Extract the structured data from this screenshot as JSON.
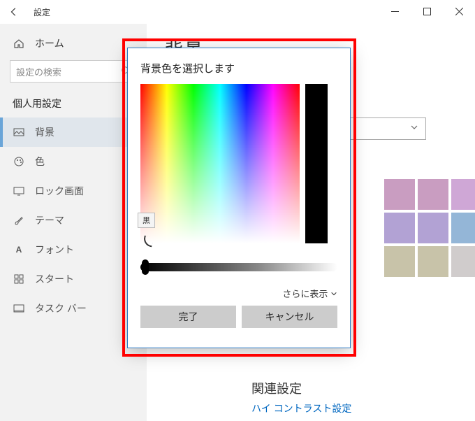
{
  "titlebar": {
    "title": "設定"
  },
  "sidebar": {
    "home": "ホーム",
    "search_placeholder": "設定の検索",
    "heading": "個人用設定",
    "items": [
      {
        "label": "背景",
        "selected": true
      },
      {
        "label": "色"
      },
      {
        "label": "ロック画面"
      },
      {
        "label": "テーマ"
      },
      {
        "label": "フォント"
      },
      {
        "label": "スタート"
      },
      {
        "label": "タスク バー"
      }
    ]
  },
  "main": {
    "title": "背景",
    "related_heading": "関連設定",
    "related_link": "ハイ コントラスト設定",
    "swatch_colors": [
      "#c99dc1",
      "#c99dc1",
      "#cfa7d6",
      "#cfa7d6",
      "#b2a2d4",
      "#b2a2d4",
      "#94b6d7",
      "#94b6d7",
      "#c8c3a9",
      "#c8c3a9",
      "#d0cccc",
      "#d0cccc"
    ]
  },
  "dialog": {
    "title": "背景色を選択します",
    "tooltip": "黒",
    "more": "さらに表示",
    "ok": "完了",
    "cancel": "キャンセル"
  }
}
